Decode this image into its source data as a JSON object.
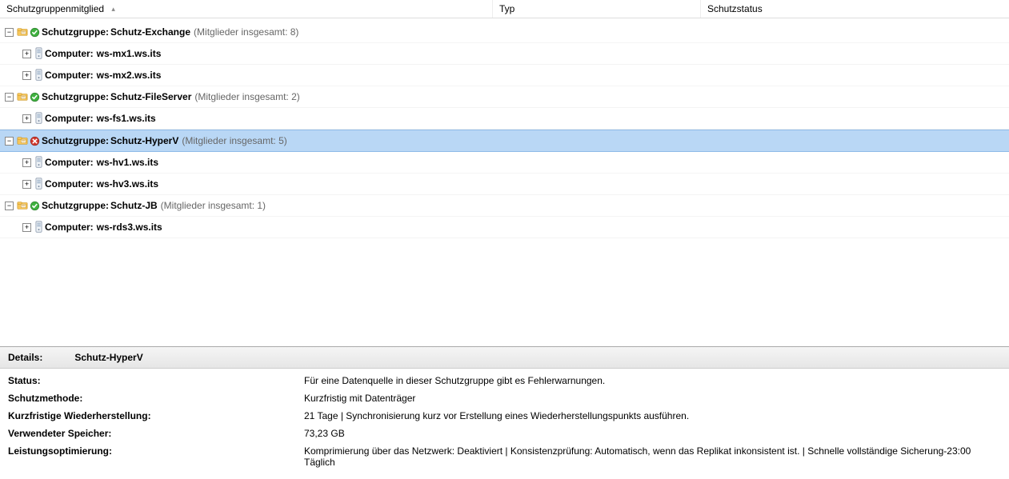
{
  "columns": {
    "member": "Schutzgruppenmitglied",
    "type": "Typ",
    "status": "Schutzstatus"
  },
  "groups": [
    {
      "id": "exchange",
      "prefix": "Schutzgruppe:",
      "name": "Schutz-Exchange",
      "members_text": "(Mitglieder insgesamt: 8)",
      "status": "ok",
      "expanded": true,
      "selected": false,
      "computers": [
        {
          "prefix": "Computer:",
          "name": "ws-mx1.ws.its"
        },
        {
          "prefix": "Computer:",
          "name": "ws-mx2.ws.its"
        }
      ]
    },
    {
      "id": "fileserver",
      "prefix": "Schutzgruppe:",
      "name": "Schutz-FileServer",
      "members_text": "(Mitglieder insgesamt: 2)",
      "status": "ok",
      "expanded": true,
      "selected": false,
      "computers": [
        {
          "prefix": "Computer:",
          "name": "ws-fs1.ws.its"
        }
      ]
    },
    {
      "id": "hyperv",
      "prefix": "Schutzgruppe:",
      "name": "Schutz-HyperV",
      "members_text": "(Mitglieder insgesamt: 5)",
      "status": "error",
      "expanded": true,
      "selected": true,
      "computers": [
        {
          "prefix": "Computer:",
          "name": "ws-hv1.ws.its"
        },
        {
          "prefix": "Computer:",
          "name": "ws-hv3.ws.its"
        }
      ]
    },
    {
      "id": "jb",
      "prefix": "Schutzgruppe:",
      "name": "Schutz-JB",
      "members_text": "(Mitglieder insgesamt: 1)",
      "status": "ok",
      "expanded": true,
      "selected": false,
      "computers": [
        {
          "prefix": "Computer:",
          "name": "ws-rds3.ws.its"
        }
      ]
    }
  ],
  "details": {
    "header_label": "Details:",
    "header_name": "Schutz-HyperV",
    "rows": [
      {
        "k": "Status:",
        "v": "Für eine Datenquelle in dieser Schutzgruppe gibt es Fehlerwarnungen."
      },
      {
        "k": "Schutzmethode:",
        "v": "Kurzfristig mit Datenträger"
      },
      {
        "k": "Kurzfristige Wiederherstellung:",
        "v": "21 Tage | Synchronisierung kurz vor Erstellung eines Wiederherstellungspunkts ausführen."
      },
      {
        "k": "Verwendeter Speicher:",
        "v": "73,23 GB"
      },
      {
        "k": "Leistungsoptimierung:",
        "v": "Komprimierung über das Netzwerk: Deaktiviert | Konsistenzprüfung: Automatisch, wenn das Replikat inkonsistent ist. | Schnelle vollständige Sicherung-23:00 Täglich"
      }
    ]
  },
  "glyphs": {
    "plus": "+",
    "minus": "−",
    "sort_asc": "▴"
  }
}
